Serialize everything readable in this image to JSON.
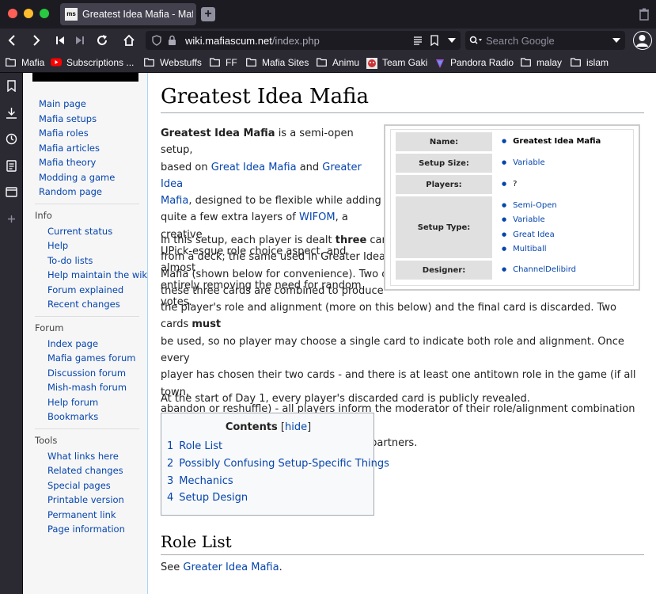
{
  "browser": {
    "tab_title": "Greatest Idea Mafia - Mafia",
    "tab_favicon_text": "ms",
    "url_domain": "wiki.mafiascum.net",
    "url_path": "/index.php",
    "search_placeholder": "Search Google"
  },
  "bookmarks": [
    {
      "label": "Mafia",
      "icon": "folder-icon"
    },
    {
      "label": "Subscriptions ...",
      "icon": "youtube-icon"
    },
    {
      "label": "Webstuffs",
      "icon": "folder-icon"
    },
    {
      "label": "FF",
      "icon": "folder-icon"
    },
    {
      "label": "Mafia Sites",
      "icon": "folder-icon"
    },
    {
      "label": "Animu",
      "icon": "folder-icon"
    },
    {
      "label": "Team Gaki",
      "icon": "team-gaki-icon"
    },
    {
      "label": "Pandora Radio",
      "icon": "pandora-icon"
    },
    {
      "label": "malay",
      "icon": "folder-icon"
    },
    {
      "label": "islam",
      "icon": "folder-icon"
    }
  ],
  "sidebar": {
    "main": [
      "Main page",
      "Mafia setups",
      "Mafia roles",
      "Mafia articles",
      "Mafia theory",
      "Modding a game",
      "Random page"
    ],
    "info_heading": "Info",
    "info": [
      "Current status",
      "Help",
      "To-do lists",
      "Help maintain the wiki",
      "Forum explained",
      "Recent changes"
    ],
    "forum_heading": "Forum",
    "forum": [
      "Index page",
      "Mafia games forum",
      "Discussion forum",
      "Mish-mash forum",
      "Help forum",
      "Bookmarks"
    ],
    "tools_heading": "Tools",
    "tools": [
      "What links here",
      "Related changes",
      "Special pages",
      "Printable version",
      "Permanent link",
      "Page information"
    ]
  },
  "article": {
    "title": "Greatest Idea Mafia",
    "p1": {
      "bold_name": "Greatest Idea Mafia",
      "t1": " is a semi-open setup,",
      "t2": "based on ",
      "link1": "Great Idea Mafia",
      "t3": " and ",
      "link2a": "Greater Idea",
      "link2b": "Mafia",
      "t4": ", designed to be flexible while adding",
      "t5": "quite a few extra layers of ",
      "link3": "WIFOM",
      "t6": ", a creative",
      "t7": "UPick-esque role choice aspect, and almost",
      "t8": "entirely removing the need for random votes."
    },
    "p2": {
      "l1a": "In this setup, each player is dealt ",
      "l1b": "three",
      "l1c": " cards",
      "l2": "from a deck; the same used in Greater Idea",
      "l3": "Mafia (shown below for convenience). Two of",
      "l4": "these three cards are combined to produce",
      "l5a": "the player's role and alignment (more on this below) and the final card is discarded. Two cards ",
      "l5b": "must",
      "l6": "be used, so no player may choose a single card to indicate both role and alignment. Once every",
      "l7": "player has chosen their two cards - and there is at least one antitown role in the game (if all town,",
      "l8": "abandon or reshuffle) - all players inform the moderator of their role/alignment combination and any",
      "l9": "roles with partners are informed of their partners."
    },
    "p3": "At the start of Day 1, every player's discarded card is publicly revealed.",
    "infobox": {
      "name_label": "Name:",
      "name_value": "Greatest Idea Mafia",
      "size_label": "Setup Size:",
      "size_value": "Variable",
      "players_label": "Players:",
      "players_value": "?",
      "type_label": "Setup Type:",
      "type_values": [
        "Semi-Open",
        "Variable",
        "Great Idea",
        "Multiball"
      ],
      "designer_label": "Designer:",
      "designer_value": "ChannelDelibird"
    },
    "toc": {
      "title": "Contents",
      "hide_open": "[",
      "hide_label": "hide",
      "hide_close": "]",
      "items": [
        {
          "num": "1",
          "label": "Role List"
        },
        {
          "num": "2",
          "label": "Possibly Confusing Setup-Specific Things"
        },
        {
          "num": "3",
          "label": "Mechanics"
        },
        {
          "num": "4",
          "label": "Setup Design"
        }
      ]
    },
    "section1_title": "Role List",
    "section1_see": "See ",
    "section1_link": "Greater Idea Mafia",
    "section1_end": "."
  }
}
